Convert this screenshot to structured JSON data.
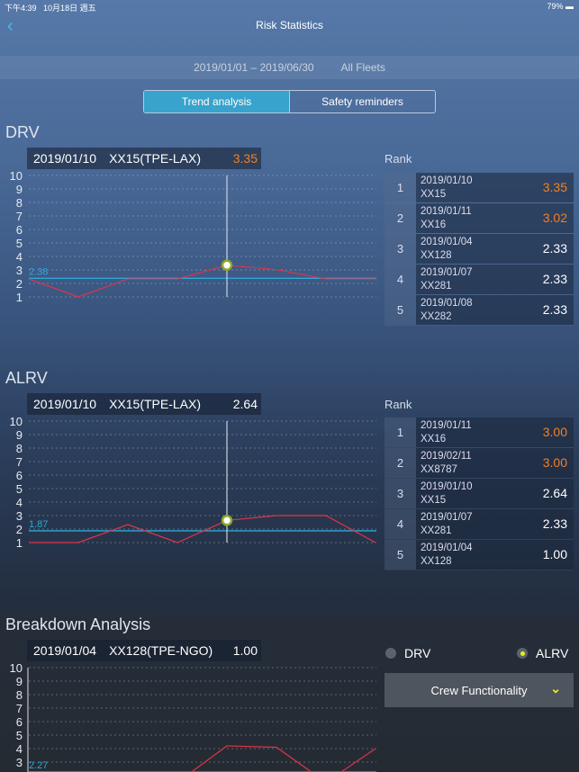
{
  "status": {
    "time": "下午4:39",
    "date": "10月18日 週五",
    "battery": "79%"
  },
  "header": {
    "title": "Risk Statistics",
    "back_icon": "chevron-left-icon"
  },
  "filter": {
    "date_range": "2019/01/01 – 2019/06/30",
    "fleet": "All Fleets"
  },
  "tabs": [
    {
      "label": "Trend analysis",
      "active": true
    },
    {
      "label": "Safety reminders",
      "active": false
    }
  ],
  "colors": {
    "accent": "#38a3cc",
    "highlight": "#f57f22",
    "line": "#e0334a",
    "average": "#2ea8d6",
    "selected": "#e6f01e"
  },
  "drv": {
    "title": "DRV",
    "info": {
      "date": "2019/01/10",
      "flight": "XX15(TPE-LAX)",
      "value": "3.35"
    },
    "rank_label": "Rank",
    "ranks": [
      {
        "n": "1",
        "date": "2019/01/10",
        "ac": "XX15",
        "value": "3.35",
        "hl": true
      },
      {
        "n": "2",
        "date": "2019/01/11",
        "ac": "XX16",
        "value": "3.02",
        "hl": true
      },
      {
        "n": "3",
        "date": "2019/01/04",
        "ac": "XX128",
        "value": "2.33",
        "hl": false
      },
      {
        "n": "4",
        "date": "2019/01/07",
        "ac": "XX281",
        "value": "2.33",
        "hl": false
      },
      {
        "n": "5",
        "date": "2019/01/08",
        "ac": "XX282",
        "value": "2.33",
        "hl": false
      }
    ]
  },
  "alrv": {
    "title": "ALRV",
    "info": {
      "date": "2019/01/10",
      "flight": "XX15(TPE-LAX)",
      "value": "2.64"
    },
    "rank_label": "Rank",
    "ranks": [
      {
        "n": "1",
        "date": "2019/01/11",
        "ac": "XX16",
        "value": "3.00",
        "hl": true
      },
      {
        "n": "2",
        "date": "2019/02/11",
        "ac": "XX8787",
        "value": "3.00",
        "hl": true
      },
      {
        "n": "3",
        "date": "2019/01/10",
        "ac": "XX15",
        "value": "2.64",
        "hl": false
      },
      {
        "n": "4",
        "date": "2019/01/07",
        "ac": "XX281",
        "value": "2.33",
        "hl": false
      },
      {
        "n": "5",
        "date": "2019/01/04",
        "ac": "XX128",
        "value": "1.00",
        "hl": false
      }
    ]
  },
  "breakdown": {
    "title": "Breakdown Analysis",
    "info": {
      "date": "2019/01/04",
      "flight": "XX128(TPE-NGO)",
      "value": "1.00"
    },
    "options": [
      {
        "label": "DRV",
        "selected": false
      },
      {
        "label": "ALRV",
        "selected": true
      }
    ],
    "dropdown": "Crew Functionality"
  },
  "chart_data": [
    {
      "type": "line",
      "name": "DRV",
      "yticks": [
        "1",
        "2",
        "3",
        "4",
        "5",
        "6",
        "7",
        "8",
        "9",
        "10"
      ],
      "ylim": [
        1,
        10
      ],
      "values": [
        2.33,
        1,
        2.33,
        2.33,
        3.35,
        3.02,
        2.33,
        2.33
      ],
      "average": 2.38,
      "average_label": "2.38",
      "selected_index": 4
    },
    {
      "type": "line",
      "name": "ALRV",
      "yticks": [
        "1",
        "2",
        "3",
        "4",
        "5",
        "6",
        "7",
        "8",
        "9",
        "10"
      ],
      "ylim": [
        1,
        10
      ],
      "values": [
        1,
        1,
        2.33,
        1,
        2.64,
        3,
        3,
        1
      ],
      "average": 1.87,
      "average_label": "1.87",
      "selected_index": 4
    },
    {
      "type": "line",
      "name": "Breakdown",
      "yticks": [
        "1",
        "2",
        "3",
        "4",
        "5",
        "6",
        "7",
        "8",
        "9",
        "10"
      ],
      "ylim": [
        1,
        10
      ],
      "values": [
        1,
        1,
        1,
        1.5,
        4.2,
        4.1,
        1.5,
        4
      ],
      "average": 2.27,
      "average_label": "2.27",
      "selected_index": null
    }
  ]
}
